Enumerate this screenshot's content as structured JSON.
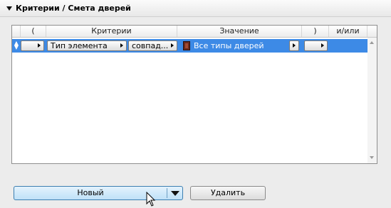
{
  "header": {
    "title": "Критерии /  Смета дверей",
    "icon": "collapse-triangle-icon"
  },
  "table": {
    "columns": [
      "(",
      "Критерии",
      "Значение",
      ")",
      "и/или"
    ],
    "rows": [
      {
        "open_paren": "",
        "criterion": "Тип элемента",
        "operator": "совпад...",
        "value": "Все типы дверей",
        "value_icon": "door-icon",
        "close_paren": "",
        "and_or": ""
      }
    ]
  },
  "buttons": {
    "new_label": "Новый",
    "delete_label": "Удалить"
  },
  "colors": {
    "selection": "#3d8ae6",
    "primary_button": "#bfe0f7",
    "background": "#ececec"
  }
}
